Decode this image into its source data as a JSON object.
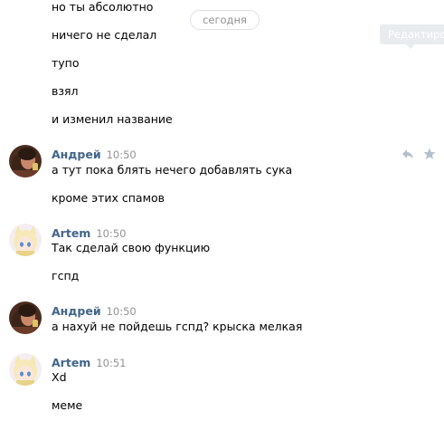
{
  "date_separator": "сегодня",
  "tooltip": "Редактиро",
  "first_group": {
    "lines": [
      "но ты абсолютно",
      "ничего не сделал",
      "тупо",
      "взял",
      "и изменил название"
    ]
  },
  "messages": [
    {
      "author": "Андрей",
      "time": "10:50",
      "avatar": "andrey-avatar",
      "lines": [
        "а тут пока блять нечего добавлять сука",
        "кроме этих спамов"
      ]
    },
    {
      "author": "Artem",
      "time": "10:50",
      "avatar": "artem-avatar",
      "lines": [
        "Так сделай свою функцию",
        "гспд"
      ]
    },
    {
      "author": "Андрей",
      "time": "10:50",
      "avatar": "andrey-avatar",
      "lines": [
        "а нахуй не пойдешь гспд? крыска мелкая"
      ]
    },
    {
      "author": "Artem",
      "time": "10:51",
      "avatar": "artem-avatar",
      "lines": [
        "Xd",
        "меме"
      ]
    }
  ],
  "actions": {
    "reply_icon": "reply-icon",
    "star_icon": "star-icon"
  },
  "colors": {
    "author": "#42648b",
    "time": "#939393",
    "date_border": "#dce1e6"
  }
}
